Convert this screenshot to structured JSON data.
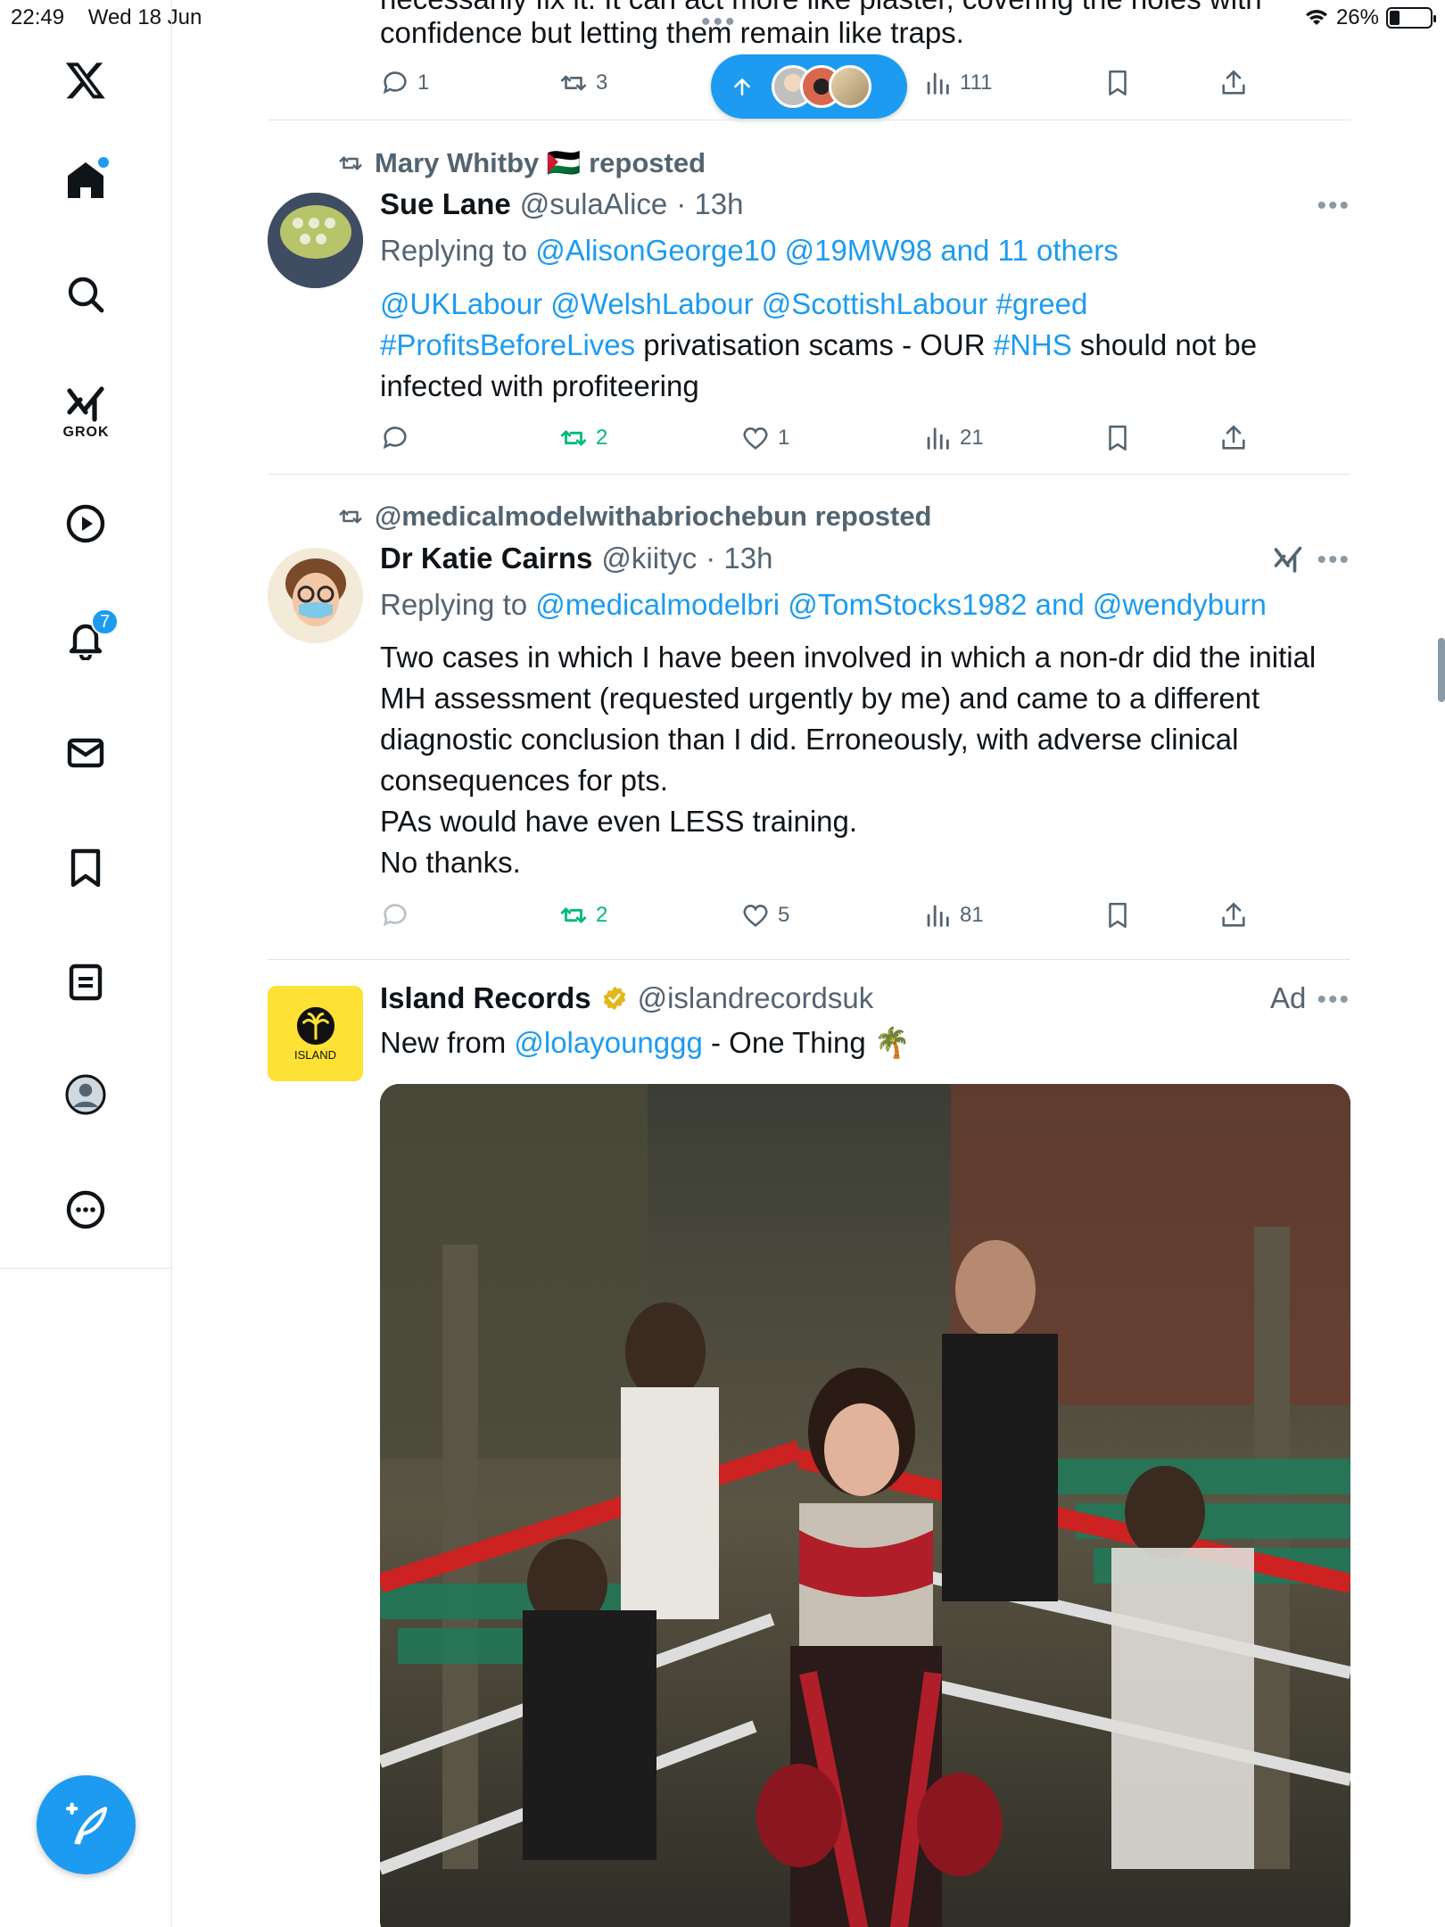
{
  "status": {
    "time": "22:49",
    "date": "Wed 18 Jun",
    "battery": "26%"
  },
  "sidebar": {
    "items": [
      {
        "name": "home"
      },
      {
        "name": "search"
      },
      {
        "name": "grok",
        "label": "GROK"
      },
      {
        "name": "video"
      },
      {
        "name": "notifications",
        "badge": "7"
      },
      {
        "name": "messages"
      },
      {
        "name": "bookmarks"
      },
      {
        "name": "lists"
      },
      {
        "name": "profile"
      },
      {
        "name": "more"
      }
    ]
  },
  "partial_post": {
    "text_top": "necessarily fix it. It can act more like plaster, covering the holes with",
    "text": "confidence but letting them remain like traps.",
    "replies": "1",
    "reposts": "3",
    "views": "111"
  },
  "post1": {
    "reposted_by": "Mary Whitby 🇵🇸 reposted",
    "name": "Sue Lane",
    "handle": "@sulaAlice",
    "time": "· 13h",
    "replying_prefix": "Replying to",
    "replying_to": "@AlisonGeorge10 @19MW98 and 11 others",
    "line1": "@UKLabour @WelshLabour @ScottishLabour #greed",
    "line2_link": "#ProfitsBeforeLives",
    "line2_a": " privatisation scams - OUR ",
    "line2_link2": "#NHS",
    "line2_b": " should not be",
    "line3": "infected with profiteering",
    "reposts": "2",
    "likes": "1",
    "views": "21"
  },
  "post2": {
    "reposted_by": "@medicalmodelwithabriochebun reposted",
    "name": "Dr Katie Cairns",
    "handle": "@kiityc",
    "time": "· 13h",
    "replying_prefix": "Replying to",
    "replying_to": "@medicalmodelbri @TomStocks1982 and @wendyburn",
    "lines": [
      "Two cases in which I have been involved in which a non-dr did the initial",
      "MH assessment (requested urgently by me) and came to a different",
      "diagnostic conclusion than I did. Erroneously, with adverse clinical",
      "consequences for pts.",
      "PAs would have even LESS training.",
      "No thanks."
    ],
    "reposts": "2",
    "likes": "5",
    "views": "81"
  },
  "ad": {
    "name": "Island Records",
    "handle": "@islandrecordsuk",
    "ad_label": "Ad",
    "text_prefix": "New from ",
    "text_link": "@lolayounggg",
    "text_suffix": " - One Thing 🌴",
    "logo_text": "ISLAND"
  },
  "colors": {
    "accent": "#1d9bf0",
    "repost_green": "#00ba7c",
    "muted": "#536471"
  }
}
